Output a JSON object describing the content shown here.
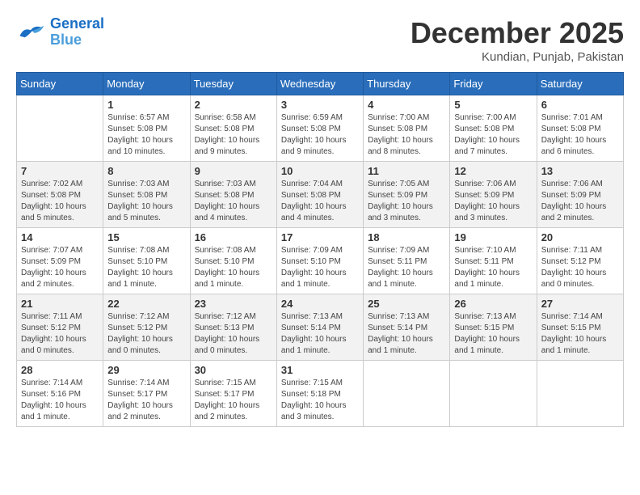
{
  "logo": {
    "line1": "General",
    "line2": "Blue"
  },
  "title": "December 2025",
  "location": "Kundian, Punjab, Pakistan",
  "days_header": [
    "Sunday",
    "Monday",
    "Tuesday",
    "Wednesday",
    "Thursday",
    "Friday",
    "Saturday"
  ],
  "weeks": [
    [
      {
        "day": "",
        "info": ""
      },
      {
        "day": "1",
        "info": "Sunrise: 6:57 AM\nSunset: 5:08 PM\nDaylight: 10 hours\nand 10 minutes."
      },
      {
        "day": "2",
        "info": "Sunrise: 6:58 AM\nSunset: 5:08 PM\nDaylight: 10 hours\nand 9 minutes."
      },
      {
        "day": "3",
        "info": "Sunrise: 6:59 AM\nSunset: 5:08 PM\nDaylight: 10 hours\nand 9 minutes."
      },
      {
        "day": "4",
        "info": "Sunrise: 7:00 AM\nSunset: 5:08 PM\nDaylight: 10 hours\nand 8 minutes."
      },
      {
        "day": "5",
        "info": "Sunrise: 7:00 AM\nSunset: 5:08 PM\nDaylight: 10 hours\nand 7 minutes."
      },
      {
        "day": "6",
        "info": "Sunrise: 7:01 AM\nSunset: 5:08 PM\nDaylight: 10 hours\nand 6 minutes."
      }
    ],
    [
      {
        "day": "7",
        "info": "Sunrise: 7:02 AM\nSunset: 5:08 PM\nDaylight: 10 hours\nand 5 minutes."
      },
      {
        "day": "8",
        "info": "Sunrise: 7:03 AM\nSunset: 5:08 PM\nDaylight: 10 hours\nand 5 minutes."
      },
      {
        "day": "9",
        "info": "Sunrise: 7:03 AM\nSunset: 5:08 PM\nDaylight: 10 hours\nand 4 minutes."
      },
      {
        "day": "10",
        "info": "Sunrise: 7:04 AM\nSunset: 5:08 PM\nDaylight: 10 hours\nand 4 minutes."
      },
      {
        "day": "11",
        "info": "Sunrise: 7:05 AM\nSunset: 5:09 PM\nDaylight: 10 hours\nand 3 minutes."
      },
      {
        "day": "12",
        "info": "Sunrise: 7:06 AM\nSunset: 5:09 PM\nDaylight: 10 hours\nand 3 minutes."
      },
      {
        "day": "13",
        "info": "Sunrise: 7:06 AM\nSunset: 5:09 PM\nDaylight: 10 hours\nand 2 minutes."
      }
    ],
    [
      {
        "day": "14",
        "info": "Sunrise: 7:07 AM\nSunset: 5:09 PM\nDaylight: 10 hours\nand 2 minutes."
      },
      {
        "day": "15",
        "info": "Sunrise: 7:08 AM\nSunset: 5:10 PM\nDaylight: 10 hours\nand 1 minute."
      },
      {
        "day": "16",
        "info": "Sunrise: 7:08 AM\nSunset: 5:10 PM\nDaylight: 10 hours\nand 1 minute."
      },
      {
        "day": "17",
        "info": "Sunrise: 7:09 AM\nSunset: 5:10 PM\nDaylight: 10 hours\nand 1 minute."
      },
      {
        "day": "18",
        "info": "Sunrise: 7:09 AM\nSunset: 5:11 PM\nDaylight: 10 hours\nand 1 minute."
      },
      {
        "day": "19",
        "info": "Sunrise: 7:10 AM\nSunset: 5:11 PM\nDaylight: 10 hours\nand 1 minute."
      },
      {
        "day": "20",
        "info": "Sunrise: 7:11 AM\nSunset: 5:12 PM\nDaylight: 10 hours\nand 0 minutes."
      }
    ],
    [
      {
        "day": "21",
        "info": "Sunrise: 7:11 AM\nSunset: 5:12 PM\nDaylight: 10 hours\nand 0 minutes."
      },
      {
        "day": "22",
        "info": "Sunrise: 7:12 AM\nSunset: 5:12 PM\nDaylight: 10 hours\nand 0 minutes."
      },
      {
        "day": "23",
        "info": "Sunrise: 7:12 AM\nSunset: 5:13 PM\nDaylight: 10 hours\nand 0 minutes."
      },
      {
        "day": "24",
        "info": "Sunrise: 7:13 AM\nSunset: 5:14 PM\nDaylight: 10 hours\nand 1 minute."
      },
      {
        "day": "25",
        "info": "Sunrise: 7:13 AM\nSunset: 5:14 PM\nDaylight: 10 hours\nand 1 minute."
      },
      {
        "day": "26",
        "info": "Sunrise: 7:13 AM\nSunset: 5:15 PM\nDaylight: 10 hours\nand 1 minute."
      },
      {
        "day": "27",
        "info": "Sunrise: 7:14 AM\nSunset: 5:15 PM\nDaylight: 10 hours\nand 1 minute."
      }
    ],
    [
      {
        "day": "28",
        "info": "Sunrise: 7:14 AM\nSunset: 5:16 PM\nDaylight: 10 hours\nand 1 minute."
      },
      {
        "day": "29",
        "info": "Sunrise: 7:14 AM\nSunset: 5:17 PM\nDaylight: 10 hours\nand 2 minutes."
      },
      {
        "day": "30",
        "info": "Sunrise: 7:15 AM\nSunset: 5:17 PM\nDaylight: 10 hours\nand 2 minutes."
      },
      {
        "day": "31",
        "info": "Sunrise: 7:15 AM\nSunset: 5:18 PM\nDaylight: 10 hours\nand 3 minutes."
      },
      {
        "day": "",
        "info": ""
      },
      {
        "day": "",
        "info": ""
      },
      {
        "day": "",
        "info": ""
      }
    ]
  ]
}
